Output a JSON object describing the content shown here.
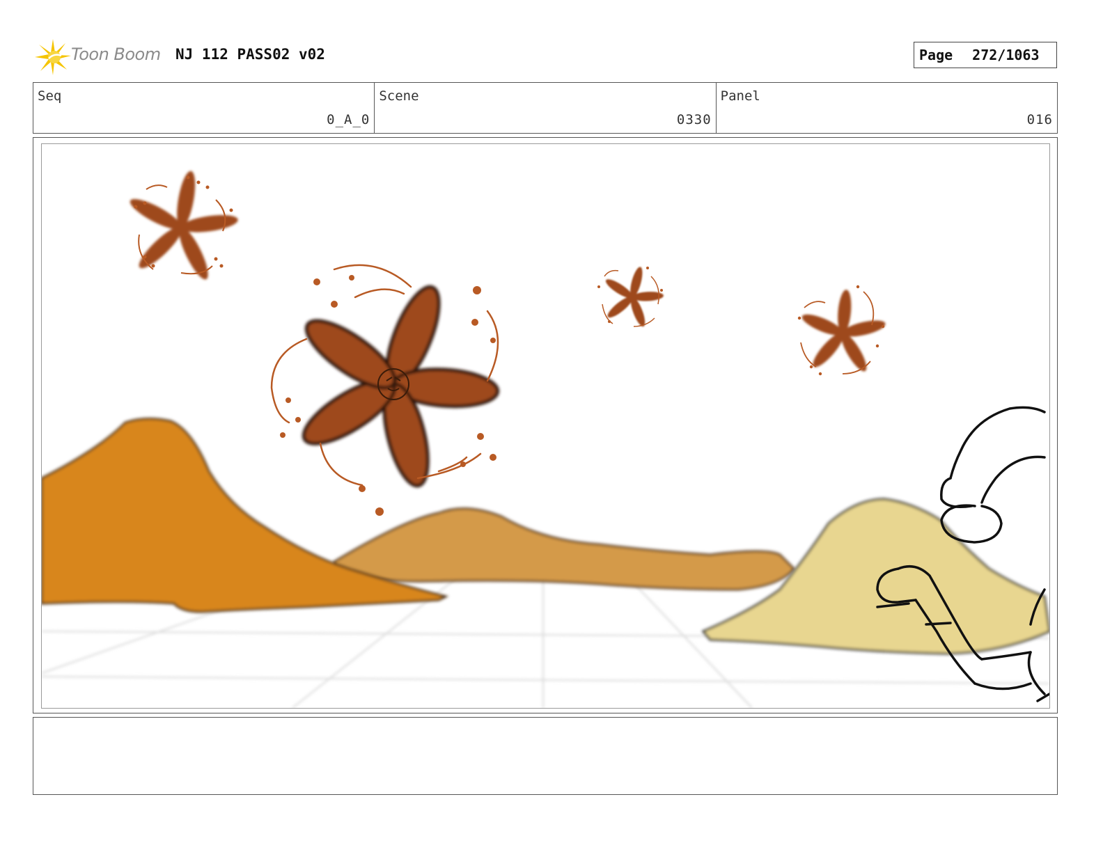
{
  "header": {
    "logo_text": "Toon Boom",
    "project_title": "NJ 112 PASS02 v02",
    "page_label": "Page",
    "page_value": "272/1063"
  },
  "info": {
    "seq_label": "Seq",
    "seq_value": "0_A_0",
    "scene_label": "Scene",
    "scene_value": "0330",
    "panel_label": "Panel",
    "panel_value": "016"
  },
  "colors": {
    "logo_star": "#f5c400",
    "hill_left": "#d8861f",
    "hill_mid": "#d49a48",
    "hill_right": "#e8d690",
    "starfish": "#9e4a1c",
    "starfish_light": "#b85a24"
  },
  "icons": {
    "logo": "toon-boom-star-icon"
  },
  "notes": ""
}
